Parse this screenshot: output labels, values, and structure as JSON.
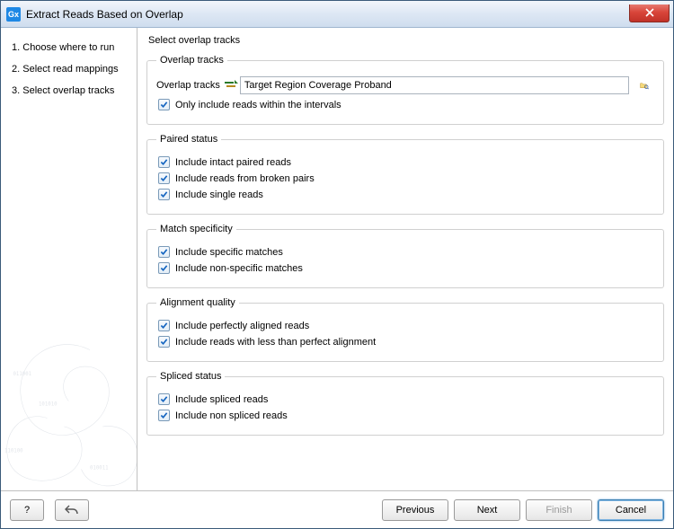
{
  "window": {
    "title": "Extract Reads Based on Overlap",
    "app_badge": "Gx"
  },
  "sidebar": {
    "steps": [
      {
        "num": "1.",
        "label": "Choose where to run"
      },
      {
        "num": "2.",
        "label": "Select read mappings"
      },
      {
        "num": "3.",
        "label": "Select overlap tracks"
      }
    ]
  },
  "main": {
    "page_heading": "Select overlap tracks",
    "groups": {
      "overlap": {
        "legend": "Overlap tracks",
        "field_label": "Overlap tracks",
        "field_value": "Target Region Coverage Proband",
        "only_within": "Only include reads within the intervals"
      },
      "paired": {
        "legend": "Paired status",
        "intact": "Include intact paired reads",
        "broken": "Include reads from broken pairs",
        "single": "Include single reads"
      },
      "match": {
        "legend": "Match specificity",
        "specific": "Include specific matches",
        "nonspecific": "Include non-specific matches"
      },
      "align": {
        "legend": "Alignment quality",
        "perfect": "Include perfectly aligned reads",
        "imperfect": "Include reads with less than perfect alignment"
      },
      "spliced": {
        "legend": "Spliced status",
        "spliced": "Include spliced reads",
        "nonspliced": "Include non spliced reads"
      }
    }
  },
  "footer": {
    "help": "?",
    "previous": "Previous",
    "next": "Next",
    "finish": "Finish",
    "cancel": "Cancel"
  }
}
